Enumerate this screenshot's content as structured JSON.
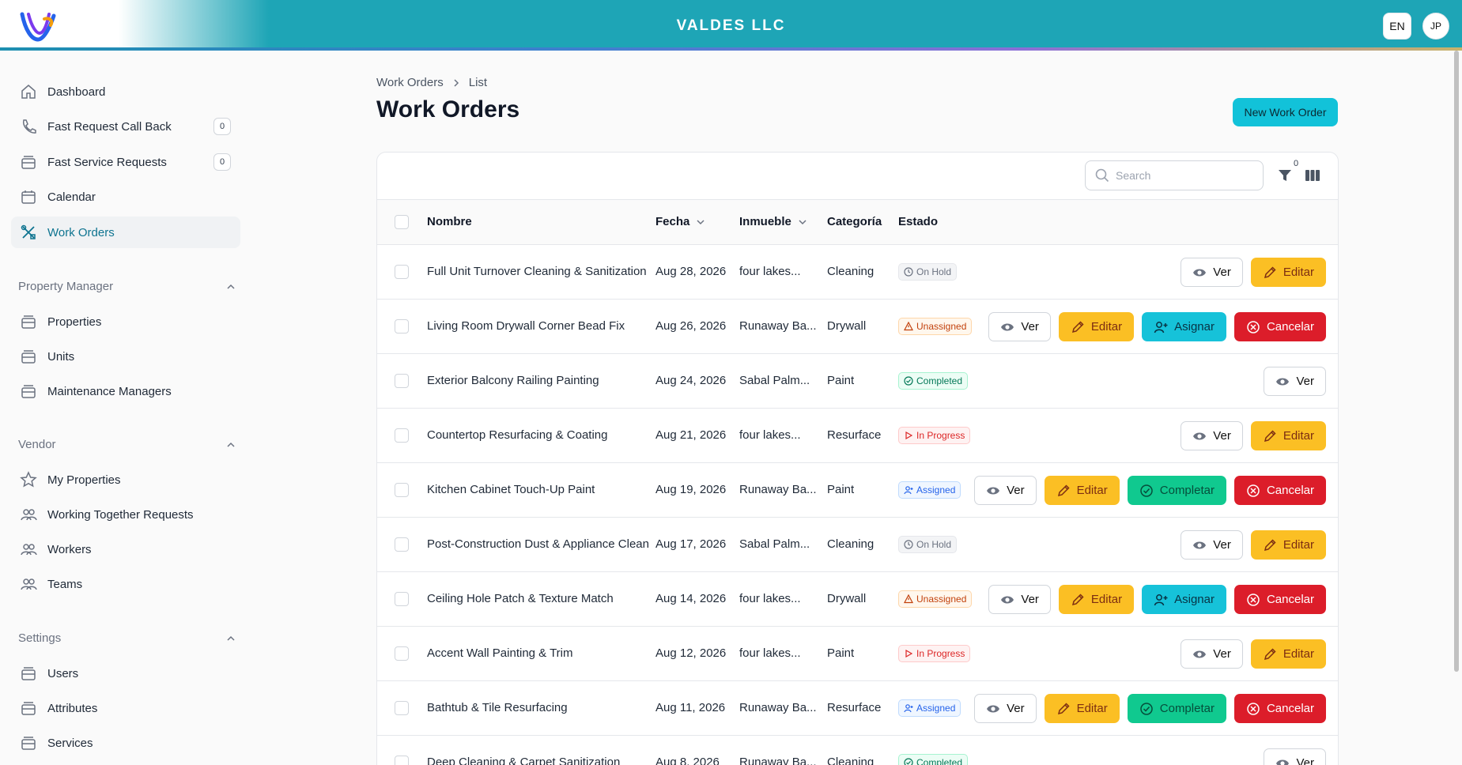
{
  "header": {
    "org_name": "VALDES LLC",
    "language": "EN",
    "user_initials": "JP",
    "colors": {
      "bar": "#1ea5b6",
      "accent": "#12c2d9"
    }
  },
  "sidebar": {
    "items": [
      {
        "label": "Dashboard",
        "icon": "home-icon"
      },
      {
        "label": "Fast Request Call Back",
        "icon": "phone-icon",
        "count": "0"
      },
      {
        "label": "Fast Service Requests",
        "icon": "tray-icon",
        "count": "0"
      },
      {
        "label": "Calendar",
        "icon": "calendar-icon"
      },
      {
        "label": "Work Orders",
        "icon": "tools-icon",
        "active": true
      }
    ],
    "sections": [
      {
        "title": "Property Manager",
        "items": [
          {
            "label": "Properties",
            "icon": "tray-icon"
          },
          {
            "label": "Units",
            "icon": "tray-icon"
          },
          {
            "label": "Maintenance Managers",
            "icon": "tray-icon"
          }
        ]
      },
      {
        "title": "Vendor",
        "items": [
          {
            "label": "My Properties",
            "icon": "star-icon"
          },
          {
            "label": "Working Together Requests",
            "icon": "users-icon"
          },
          {
            "label": "Workers",
            "icon": "users-icon"
          },
          {
            "label": "Teams",
            "icon": "users-icon"
          }
        ]
      },
      {
        "title": "Settings",
        "items": [
          {
            "label": "Users",
            "icon": "tray-icon"
          },
          {
            "label": "Attributes",
            "icon": "tray-icon"
          },
          {
            "label": "Services",
            "icon": "tray-icon"
          }
        ]
      }
    ]
  },
  "main": {
    "breadcrumb": [
      "Work Orders",
      "List"
    ],
    "title": "Work Orders",
    "new_button": "New Work Order",
    "search_placeholder": "Search",
    "filter_count": "0",
    "columns": [
      "Nombre",
      "Fecha",
      "Inmueble",
      "Categoría",
      "Estado"
    ],
    "button_labels": {
      "ver": "Ver",
      "editar": "Editar",
      "asignar": "Asignar",
      "completar": "Completar",
      "cancelar": "Cancelar"
    },
    "rows": [
      {
        "name": "Full Unit Turnover Cleaning & Sanitization",
        "date": "Aug 28, 2026",
        "property": "four lakes...",
        "category": "Cleaning",
        "status": "On Hold",
        "actions": [
          "ver",
          "editar"
        ]
      },
      {
        "name": "Living Room Drywall Corner Bead Fix",
        "date": "Aug 26, 2026",
        "property": "Runaway Ba...",
        "category": "Drywall",
        "status": "Unassigned",
        "actions": [
          "ver",
          "editar",
          "asignar",
          "cancelar"
        ]
      },
      {
        "name": "Exterior Balcony Railing Painting",
        "date": "Aug 24, 2026",
        "property": "Sabal Palm...",
        "category": "Paint",
        "status": "Completed",
        "actions": [
          "ver"
        ]
      },
      {
        "name": "Countertop Resurfacing & Coating",
        "date": "Aug 21, 2026",
        "property": "four lakes...",
        "category": "Resurface",
        "status": "In Progress",
        "actions": [
          "ver",
          "editar"
        ]
      },
      {
        "name": "Kitchen Cabinet Touch-Up Paint",
        "date": "Aug 19, 2026",
        "property": "Runaway Ba...",
        "category": "Paint",
        "status": "Assigned",
        "actions": [
          "ver",
          "editar",
          "completar",
          "cancelar"
        ]
      },
      {
        "name": "Post-Construction Dust & Appliance Clean",
        "date": "Aug 17, 2026",
        "property": "Sabal Palm...",
        "category": "Cleaning",
        "status": "On Hold",
        "actions": [
          "ver",
          "editar"
        ]
      },
      {
        "name": "Ceiling Hole Patch & Texture Match",
        "date": "Aug 14, 2026",
        "property": "four lakes...",
        "category": "Drywall",
        "status": "Unassigned",
        "actions": [
          "ver",
          "editar",
          "asignar",
          "cancelar"
        ]
      },
      {
        "name": "Accent Wall Painting & Trim",
        "date": "Aug 12, 2026",
        "property": "four lakes...",
        "category": "Paint",
        "status": "In Progress",
        "actions": [
          "ver",
          "editar"
        ]
      },
      {
        "name": "Bathtub & Tile Resurfacing",
        "date": "Aug 11, 2026",
        "property": "Runaway Ba...",
        "category": "Resurface",
        "status": "Assigned",
        "actions": [
          "ver",
          "editar",
          "completar",
          "cancelar"
        ]
      },
      {
        "name": "Deep Cleaning & Carpet Sanitization",
        "date": "Aug 8, 2026",
        "property": "Runaway Ba...",
        "category": "Cleaning",
        "status": "Completed",
        "actions": [
          "ver"
        ]
      }
    ]
  }
}
